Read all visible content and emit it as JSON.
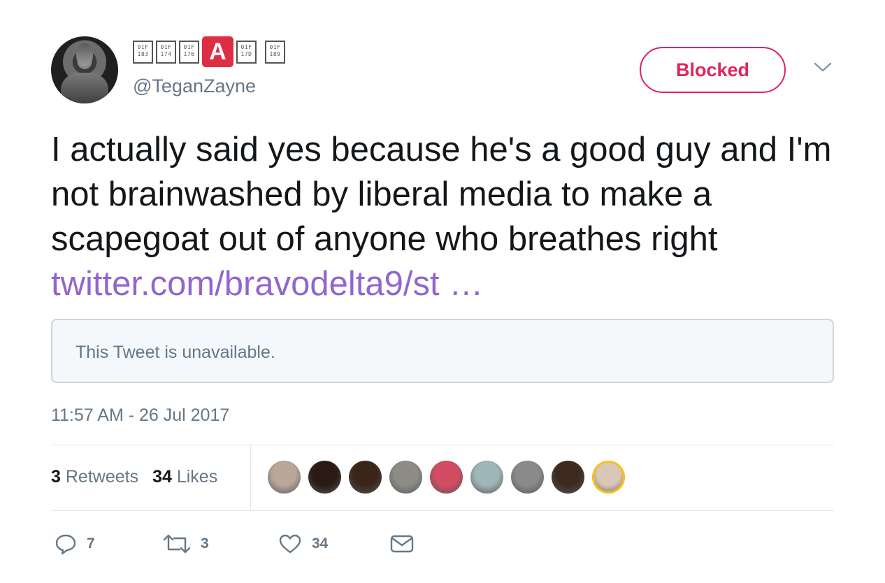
{
  "user": {
    "display_name_glyphs": [
      "01F\n183",
      "01F\n174",
      "01F\n176",
      "A",
      "01F\n17D",
      "01F\n189"
    ],
    "handle": "@TeganZayne"
  },
  "header": {
    "blocked_label": "Blocked",
    "caret_icon": "chevron-down-icon"
  },
  "tweet": {
    "text": "I actually said yes because he's a good guy and I'm not brainwashed by liberal media to make a scapegoat out of anyone who breathes right",
    "link": "twitter.com/bravodelta9/st …",
    "quoted_unavailable": "This Tweet is unavailable.",
    "timestamp": "11:57 AM - 26 Jul 2017"
  },
  "stats": {
    "retweets_count": "3",
    "retweets_label": "Retweets",
    "likes_count": "34",
    "likes_label": "Likes"
  },
  "likers": [
    {
      "color": "#b9a79a"
    },
    {
      "color": "#2a1a14"
    },
    {
      "color": "#3a2618"
    },
    {
      "color": "#8d8d86"
    },
    {
      "color": "#d34d62"
    },
    {
      "color": "#9fb6b9"
    },
    {
      "color": "#8a8a8a"
    },
    {
      "color": "#3d2a1f"
    },
    {
      "color": "#d9c7b7"
    }
  ],
  "actions": {
    "reply_count": "7",
    "retweet_count": "3",
    "like_count": "34"
  },
  "colors": {
    "accent_red": "#e0245e",
    "link_purple": "#9266cc",
    "muted": "#657786"
  }
}
